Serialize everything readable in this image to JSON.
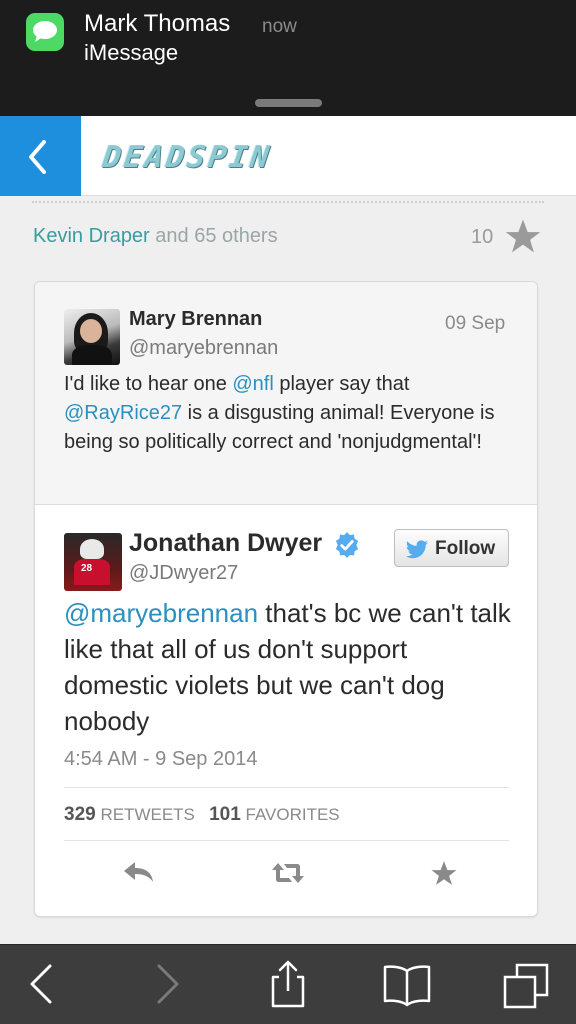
{
  "notification": {
    "sender": "Mark Thomas",
    "time": "now",
    "app": "iMessage",
    "icon": "messages-icon",
    "icon_color": "#4cd964"
  },
  "header": {
    "back_icon": "chevron-left-icon",
    "logo_text": "DEADSPIN",
    "accent_color": "#1e8fdc"
  },
  "meta": {
    "author": "Kevin Draper",
    "others": "and 65 others",
    "like_count": "10"
  },
  "quoted_tweet": {
    "name": "Mary Brennan",
    "handle": "@maryebrennan",
    "date": "09 Sep",
    "text_before_1": "I'd like to hear one ",
    "mention_1": "@nfl",
    "text_after_1": " player say that ",
    "mention_2": "@RayRice27",
    "text_after_2": " is a disgusting animal! Everyone is being so politically correct and 'nonjudgmental'!"
  },
  "main_tweet": {
    "name": "Jonathan Dwyer",
    "handle": "@JDwyer27",
    "follow_label": "Follow",
    "mention": "@maryebrennan",
    "text": " that's bc we can't talk like that all of us don't support domestic violets but we can't dog nobody",
    "timestamp": "4:54 AM - 9 Sep 2014",
    "retweets_count": "329",
    "retweets_label": "RETWEETS",
    "favorites_count": "101",
    "favorites_label": "FAVORITES",
    "jersey_number": "28"
  },
  "toolbar": {
    "items": [
      "back-icon",
      "forward-icon",
      "share-icon",
      "bookmarks-icon",
      "tabs-icon"
    ]
  }
}
